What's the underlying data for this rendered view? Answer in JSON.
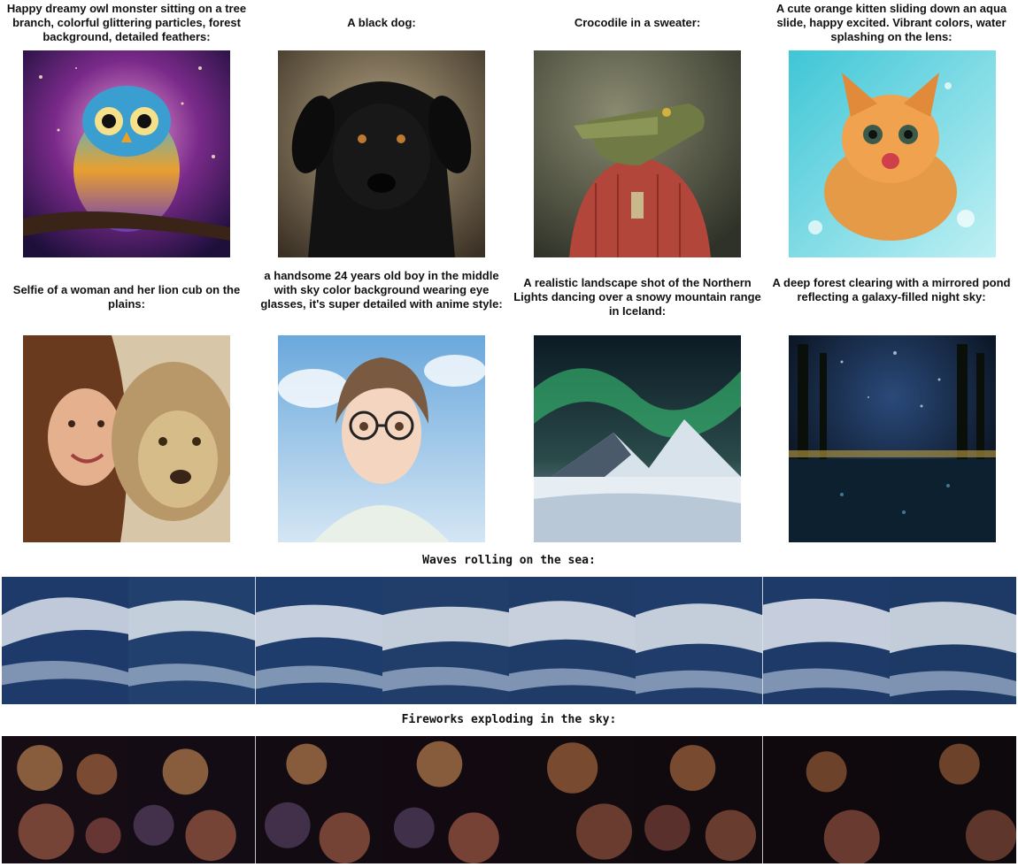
{
  "grid": {
    "captions": [
      "Happy dreamy owl monster sitting on a tree branch, colorful glittering particles, forest background, detailed feathers:",
      "A black dog:",
      "Crocodile in a sweater:",
      "A cute orange kitten sliding down an aqua slide, happy excited. Vibrant colors, water splashing on the lens:",
      "Selfie of a woman and her lion cub on the plains:",
      "a handsome 24 years old boy in the middle with sky color background wearing eye glasses, it's super detailed with anime style:",
      "A realistic landscape shot of the Northern Lights dancing over a snowy mountain range in Iceland:",
      "A deep forest clearing with a mirrored pond reflecting a galaxy-filled night sky:"
    ]
  },
  "strips": [
    {
      "caption": "Waves rolling on the sea:",
      "frames": 8
    },
    {
      "caption": "Fireworks exploding in the sky:",
      "frames": 8
    }
  ]
}
